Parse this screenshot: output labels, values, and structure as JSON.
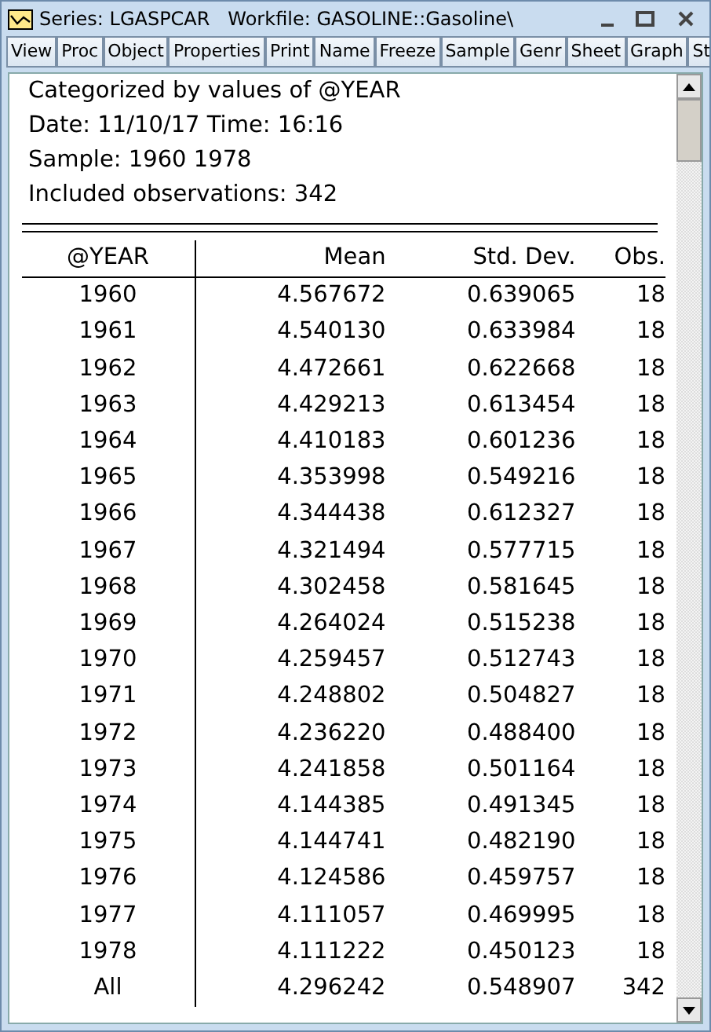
{
  "window": {
    "title": "Series: LGASPCAR   Workfile: GASOLINE::Gasoline\\"
  },
  "toolbar": [
    [
      "View",
      "Proc",
      "Object",
      "Properties"
    ],
    [
      "Print",
      "Name",
      "Freeze"
    ],
    [
      "Sample",
      "Genr",
      "Sheet",
      "Graph",
      "St"
    ]
  ],
  "header_lines": [
    "Categorized by values of @YEAR",
    "Date: 11/10/17   Time: 16:16",
    "Sample: 1960 1978",
    "Included observations: 342"
  ],
  "table": {
    "columns": [
      "@YEAR",
      "Mean",
      "Std. Dev.",
      "Obs."
    ],
    "rows": [
      [
        "1960",
        "4.567672",
        "0.639065",
        "18"
      ],
      [
        "1961",
        "4.540130",
        "0.633984",
        "18"
      ],
      [
        "1962",
        "4.472661",
        "0.622668",
        "18"
      ],
      [
        "1963",
        "4.429213",
        "0.613454",
        "18"
      ],
      [
        "1964",
        "4.410183",
        "0.601236",
        "18"
      ],
      [
        "1965",
        "4.353998",
        "0.549216",
        "18"
      ],
      [
        "1966",
        "4.344438",
        "0.612327",
        "18"
      ],
      [
        "1967",
        "4.321494",
        "0.577715",
        "18"
      ],
      [
        "1968",
        "4.302458",
        "0.581645",
        "18"
      ],
      [
        "1969",
        "4.264024",
        "0.515238",
        "18"
      ],
      [
        "1970",
        "4.259457",
        "0.512743",
        "18"
      ],
      [
        "1971",
        "4.248802",
        "0.504827",
        "18"
      ],
      [
        "1972",
        "4.236220",
        "0.488400",
        "18"
      ],
      [
        "1973",
        "4.241858",
        "0.501164",
        "18"
      ],
      [
        "1974",
        "4.144385",
        "0.491345",
        "18"
      ],
      [
        "1975",
        "4.144741",
        "0.482190",
        "18"
      ],
      [
        "1976",
        "4.124586",
        "0.459757",
        "18"
      ],
      [
        "1977",
        "4.111057",
        "0.469995",
        "18"
      ],
      [
        "1978",
        "4.111222",
        "0.450123",
        "18"
      ],
      [
        "All",
        "4.296242",
        "0.548907",
        "342"
      ]
    ]
  }
}
